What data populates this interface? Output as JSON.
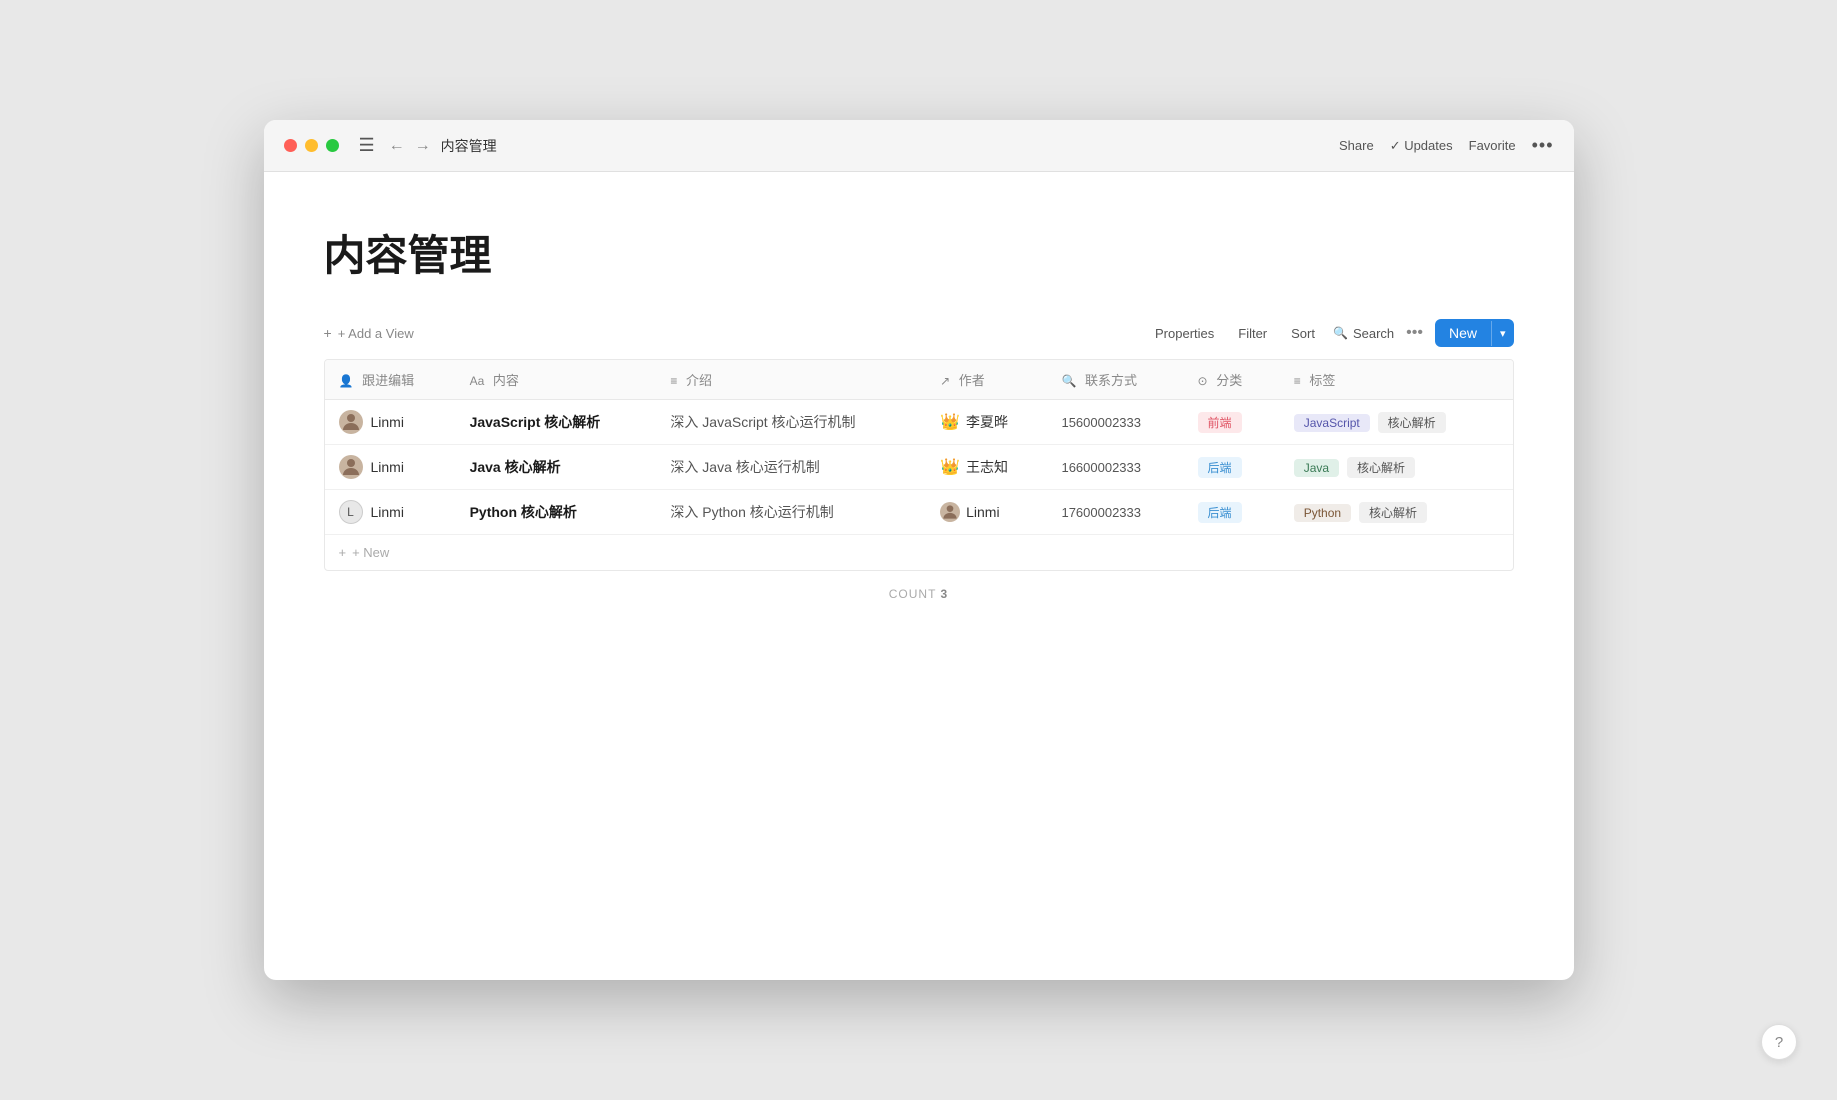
{
  "window": {
    "title": "内容管理",
    "titlebar": {
      "menu_icon": "☰",
      "back_icon": "←",
      "forward_icon": "→",
      "title": "内容管理",
      "actions": [
        {
          "label": "Share",
          "key": "share"
        },
        {
          "label": "✓ Updates",
          "key": "updates"
        },
        {
          "label": "Favorite",
          "key": "favorite"
        },
        {
          "label": "•••",
          "key": "more"
        }
      ]
    }
  },
  "page": {
    "title": "内容管理"
  },
  "toolbar": {
    "add_view_label": "+ Add a View",
    "properties_label": "Properties",
    "filter_label": "Filter",
    "sort_label": "Sort",
    "search_label": "Search",
    "more_label": "•••",
    "new_label": "New",
    "new_chevron": "▾"
  },
  "table": {
    "columns": [
      {
        "key": "editor",
        "icon": "👤",
        "label": "跟进编辑"
      },
      {
        "key": "content",
        "icon": "Aa",
        "label": "内容"
      },
      {
        "key": "intro",
        "icon": "≡",
        "label": "介绍"
      },
      {
        "key": "author",
        "icon": "↗",
        "label": "作者"
      },
      {
        "key": "contact",
        "icon": "🔍",
        "label": "联系方式"
      },
      {
        "key": "category",
        "icon": "⊙",
        "label": "分类"
      },
      {
        "key": "tags",
        "icon": "≡",
        "label": "标签"
      }
    ],
    "rows": [
      {
        "editor": "Linmi",
        "editor_avatar": "person",
        "content": "JavaScript 核心解析",
        "intro": "深入 JavaScript 核心运行机制",
        "author": "李夏晔",
        "author_emoji": "👑",
        "contact": "15600002333",
        "category": "前端",
        "category_type": "frontend",
        "tags": [
          {
            "label": "JavaScript",
            "type": "javascript"
          },
          {
            "label": "核心解析",
            "type": "core"
          }
        ]
      },
      {
        "editor": "Linmi",
        "editor_avatar": "person",
        "content": "Java 核心解析",
        "intro": "深入 Java 核心运行机制",
        "author": "王志知",
        "author_emoji": "👑",
        "contact": "16600002333",
        "category": "后端",
        "category_type": "backend",
        "tags": [
          {
            "label": "Java",
            "type": "java"
          },
          {
            "label": "核心解析",
            "type": "core"
          }
        ]
      },
      {
        "editor": "Linmi",
        "editor_avatar": "letter-L",
        "content": "Python 核心解析",
        "intro": "深入 Python 核心运行机制",
        "author": "Linmi",
        "author_emoji": "person",
        "contact": "17600002333",
        "category": "后端",
        "category_type": "backend",
        "tags": [
          {
            "label": "Python",
            "type": "python"
          },
          {
            "label": "核心解析",
            "type": "core"
          }
        ]
      }
    ],
    "add_new_label": "+ New",
    "count_label": "COUNT",
    "count_value": "3"
  },
  "help": {
    "label": "?"
  }
}
